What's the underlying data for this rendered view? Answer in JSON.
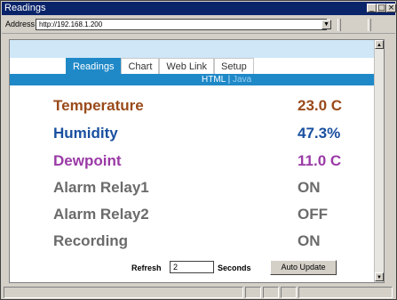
{
  "window": {
    "title": "Readings",
    "title_buttons": [
      "_",
      "□",
      "×"
    ]
  },
  "addressbar": {
    "label": "Address",
    "url": "http://192.168.1.200"
  },
  "tabs": [
    {
      "label": "Readings",
      "active": true
    },
    {
      "label": "Chart",
      "active": false
    },
    {
      "label": "Web Link",
      "active": false
    },
    {
      "label": "Setup",
      "active": false
    }
  ],
  "subnav": {
    "html_label": "HTML",
    "separator": "|",
    "java_label": "Java"
  },
  "readings": [
    {
      "name": "Temperature",
      "value": "23.0 C",
      "color": "#9a4a1a"
    },
    {
      "name": "Humidity",
      "value": "47.3%",
      "color": "#1a50a0"
    },
    {
      "name": "Dewpoint",
      "value": "11.0 C",
      "color": "#9a3aa6"
    },
    {
      "name": "Alarm Relay1",
      "value": "ON",
      "color": "#6b6b6b"
    },
    {
      "name": "Alarm Relay2",
      "value": "OFF",
      "color": "#6b6b6b"
    },
    {
      "name": "Recording",
      "value": "ON",
      "color": "#6b6b6b"
    }
  ],
  "controls": {
    "refresh_label": "Refresh",
    "refresh_value": "2",
    "seconds_label": "Seconds",
    "auto_update_label": "Auto Update"
  },
  "colors": {
    "tab_active": "#1f89c8",
    "top_band": "#cfe7f7"
  }
}
